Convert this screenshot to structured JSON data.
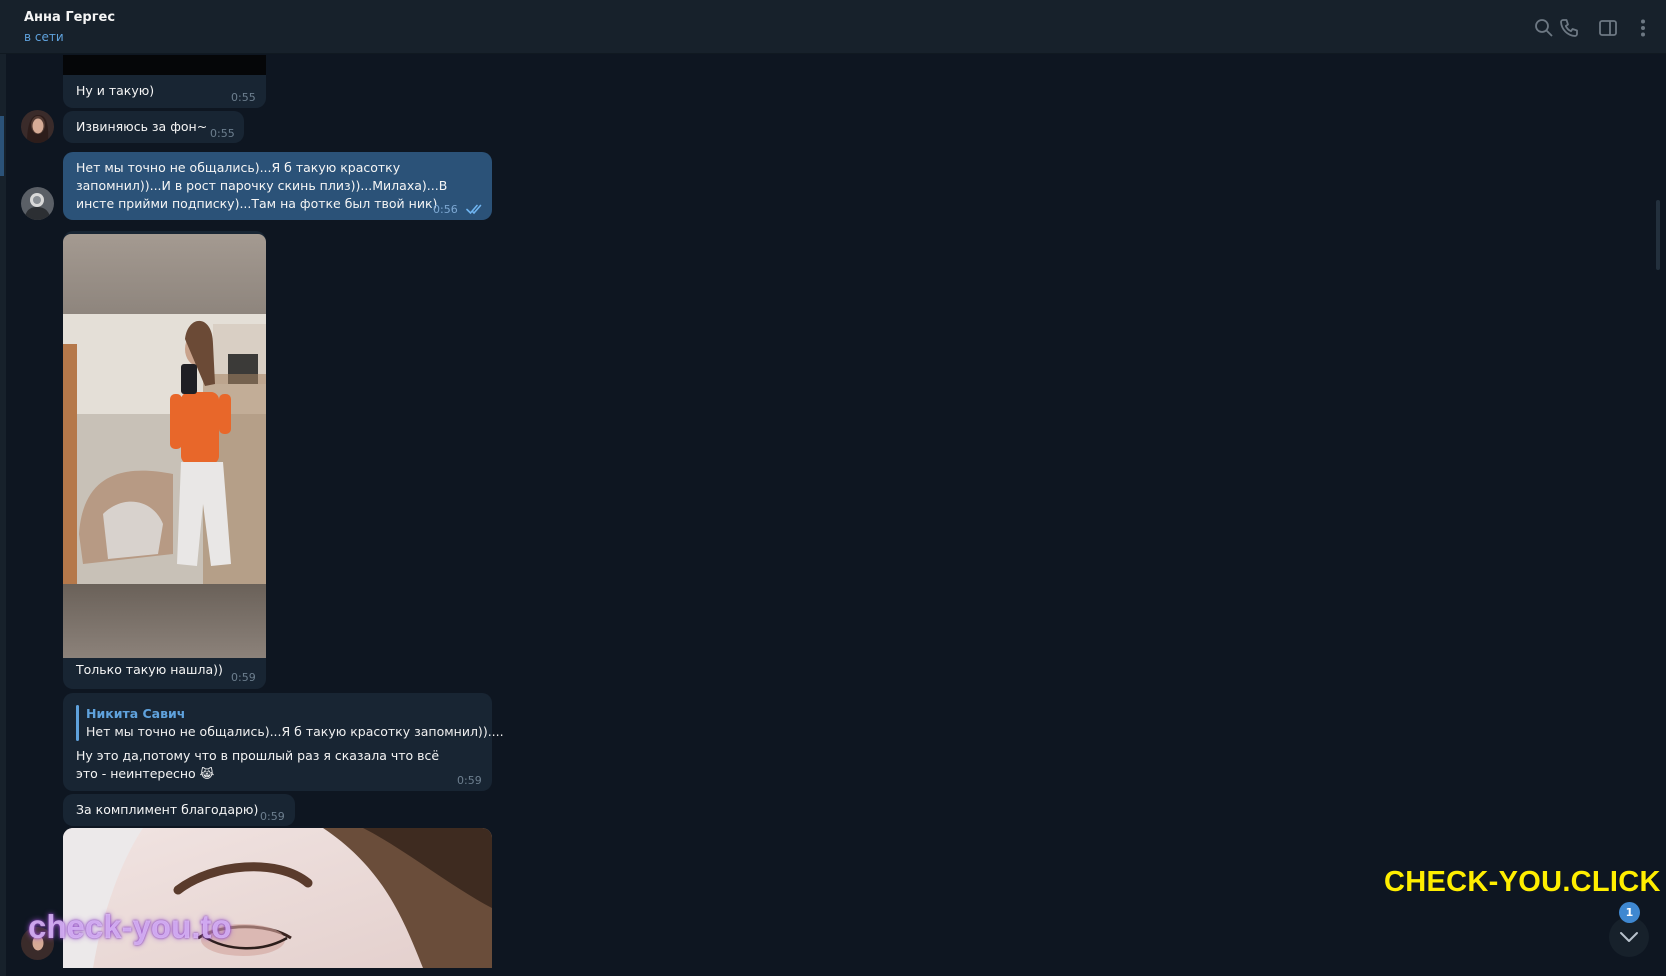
{
  "header": {
    "contact_name": "Анна Гергес",
    "contact_status": "в сети",
    "icons": [
      "search-icon",
      "phone-icon",
      "sidebar-toggle-icon",
      "more-vert-icon"
    ]
  },
  "messages": [
    {
      "direction": "in",
      "type": "photo-caption",
      "text": "Ну и такую)",
      "time": "0:55"
    },
    {
      "direction": "in",
      "type": "text",
      "text": "Извиняюсь за фон~",
      "time": "0:55"
    },
    {
      "direction": "out",
      "type": "text",
      "text": "Нет мы точно не общались)...Я б такую красотку запомнил))...И в рост парочку скинь плиз))...Милаха)...В инсте прийми подписку)...Там на фотке был твой ник)",
      "time": "0:56",
      "read": true
    },
    {
      "direction": "in",
      "type": "photo",
      "text": "Только такую нашла))",
      "time": "0:59"
    },
    {
      "direction": "in",
      "type": "reply",
      "reply_author": "Никита Савич",
      "reply_text": "Нет мы точно не общались)...Я б такую красотку запомнил))....",
      "text": "Ну это да,потому что в прошлый раз я сказала что всё это - неинтересно 😹",
      "time": "0:59"
    },
    {
      "direction": "in",
      "type": "text",
      "text": "За комплимент благодарю)",
      "time": "0:59"
    },
    {
      "direction": "in",
      "type": "photo",
      "text": "",
      "time": ""
    }
  ],
  "watermarks": {
    "big": "CHECK-YOU.CLICK",
    "small": "check-you.to"
  },
  "scroll_down": {
    "unread_count": "1"
  },
  "colors": {
    "background": "#0e1621",
    "header": "#17212b",
    "incoming_bubble": "#182533",
    "outgoing_bubble": "#2b5278",
    "accent": "#5fa2dd",
    "watermark": "#ffee00"
  }
}
